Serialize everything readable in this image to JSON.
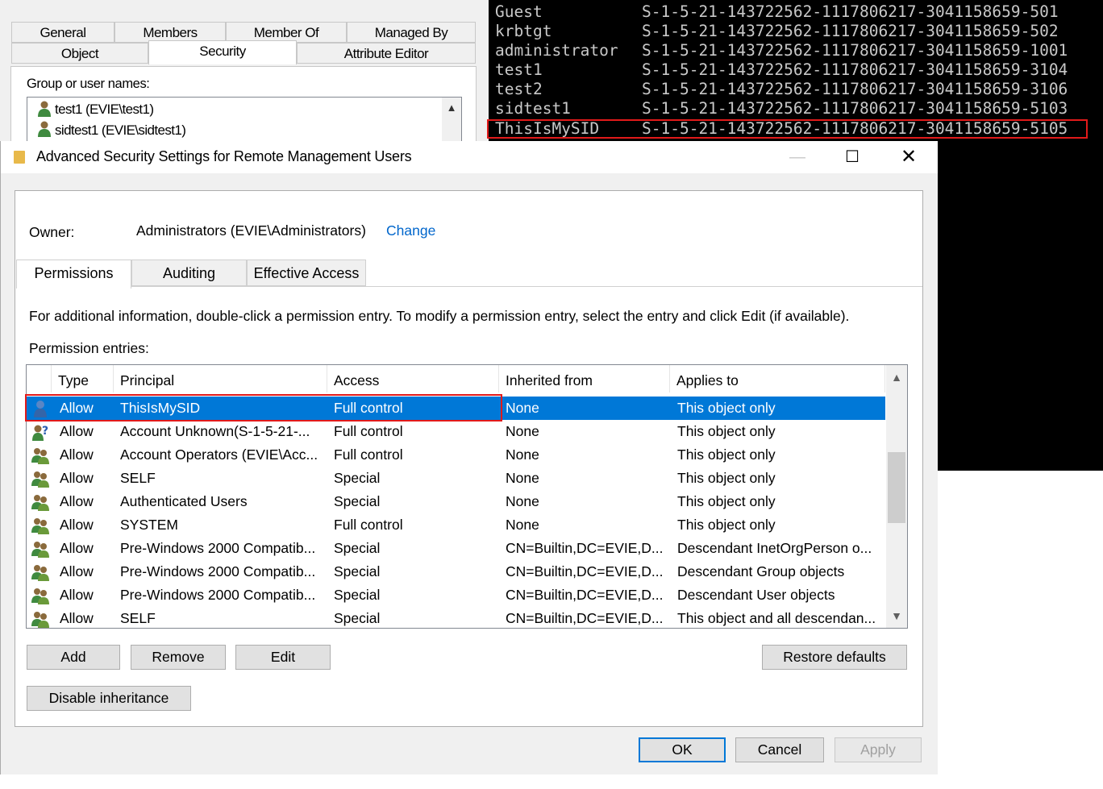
{
  "background_dialog": {
    "tabs_row1": [
      "General",
      "Members",
      "Member Of",
      "Managed By"
    ],
    "tabs_row2": [
      "Object",
      "Security",
      "Attribute Editor"
    ],
    "group_label": "Group or user names:",
    "groups": [
      "test1 (EVIE\\test1)",
      "sidtest1 (EVIE\\sidtest1)"
    ]
  },
  "console": {
    "rows": [
      {
        "name": "Guest",
        "sid": "S-1-5-21-143722562-1117806217-3041158659-501"
      },
      {
        "name": "krbtgt",
        "sid": "S-1-5-21-143722562-1117806217-3041158659-502"
      },
      {
        "name": "administrator",
        "sid": "S-1-5-21-143722562-1117806217-3041158659-1001"
      },
      {
        "name": "test1",
        "sid": "S-1-5-21-143722562-1117806217-3041158659-3104"
      },
      {
        "name": "test2",
        "sid": "S-1-5-21-143722562-1117806217-3041158659-3106"
      },
      {
        "name": "sidtest1",
        "sid": "S-1-5-21-143722562-1117806217-3041158659-5103"
      },
      {
        "name": "ThisIsMySID",
        "sid": "S-1-5-21-143722562-1117806217-3041158659-5105"
      }
    ]
  },
  "window": {
    "title": "Advanced Security Settings for Remote Management Users",
    "owner_label": "Owner:",
    "owner_value": "Administrators (EVIE\\Administrators)",
    "change_link": "Change",
    "tabs": [
      "Permissions",
      "Auditing",
      "Effective Access"
    ],
    "info_text": "For additional information, double-click a permission entry. To modify a permission entry, select the entry and click Edit (if available).",
    "entries_label": "Permission entries:",
    "columns": [
      "Type",
      "Principal",
      "Access",
      "Inherited from",
      "Applies to"
    ],
    "rows": [
      {
        "type": "Allow",
        "principal": "ThisIsMySID",
        "access": "Full control",
        "inherited": "None",
        "applies": "This object only",
        "icon": "user-icon"
      },
      {
        "type": "Allow",
        "principal": "Account Unknown(S-1-5-21-...",
        "access": "Full control",
        "inherited": "None",
        "applies": "This object only",
        "icon": "unknown-user-icon"
      },
      {
        "type": "Allow",
        "principal": "Account Operators (EVIE\\Acc...",
        "access": "Full control",
        "inherited": "None",
        "applies": "This object only",
        "icon": "group-icon"
      },
      {
        "type": "Allow",
        "principal": "SELF",
        "access": "Special",
        "inherited": "None",
        "applies": "This object only",
        "icon": "group-icon"
      },
      {
        "type": "Allow",
        "principal": "Authenticated Users",
        "access": "Special",
        "inherited": "None",
        "applies": "This object only",
        "icon": "group-icon"
      },
      {
        "type": "Allow",
        "principal": "SYSTEM",
        "access": "Full control",
        "inherited": "None",
        "applies": "This object only",
        "icon": "group-icon"
      },
      {
        "type": "Allow",
        "principal": "Pre-Windows 2000 Compatib...",
        "access": "Special",
        "inherited": "CN=Builtin,DC=EVIE,D...",
        "applies": "Descendant InetOrgPerson o...",
        "icon": "group-icon"
      },
      {
        "type": "Allow",
        "principal": "Pre-Windows 2000 Compatib...",
        "access": "Special",
        "inherited": "CN=Builtin,DC=EVIE,D...",
        "applies": "Descendant Group objects",
        "icon": "group-icon"
      },
      {
        "type": "Allow",
        "principal": "Pre-Windows 2000 Compatib...",
        "access": "Special",
        "inherited": "CN=Builtin,DC=EVIE,D...",
        "applies": "Descendant User objects",
        "icon": "group-icon"
      },
      {
        "type": "Allow",
        "principal": "SELF",
        "access": "Special",
        "inherited": "CN=Builtin,DC=EVIE,D...",
        "applies": "This object and all descendan...",
        "icon": "group-icon"
      }
    ],
    "buttons": {
      "add": "Add",
      "remove": "Remove",
      "edit": "Edit",
      "restore": "Restore defaults",
      "disable_inheritance": "Disable inheritance",
      "ok": "OK",
      "cancel": "Cancel",
      "apply": "Apply"
    }
  },
  "colors": {
    "selection": "#0078d7",
    "highlight_box": "#e21a1a",
    "link": "#0066cc",
    "console_bg": "#000000"
  }
}
